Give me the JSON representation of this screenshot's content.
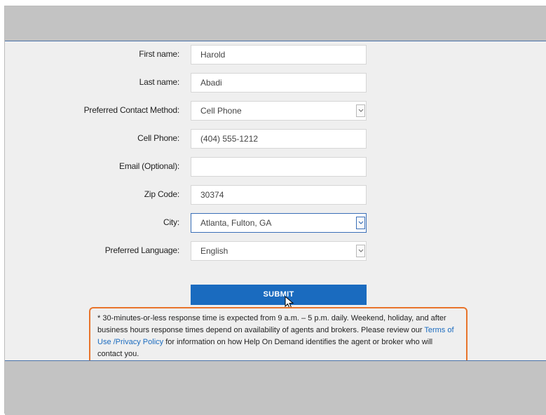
{
  "form": {
    "fields": [
      {
        "label": "First name:",
        "value": "Harold",
        "type": "text"
      },
      {
        "label": "Last name:",
        "value": "Abadi",
        "type": "text"
      },
      {
        "label": "Preferred Contact Method:",
        "value": "Cell Phone",
        "type": "select"
      },
      {
        "label": "Cell Phone:",
        "value": "(404) 555-1212",
        "type": "text"
      },
      {
        "label": "Email (Optional):",
        "value": "",
        "type": "text"
      },
      {
        "label": "Zip Code:",
        "value": "30374",
        "type": "text"
      },
      {
        "label": "City:",
        "value": "Atlanta, Fulton, GA",
        "type": "select"
      },
      {
        "label": "Preferred Language:",
        "value": "English",
        "type": "select"
      }
    ],
    "submit_label": "SUBMIT"
  },
  "notice": {
    "text_before": "* 30-minutes-or-less response time is expected from 9 a.m. – 5 p.m. daily. Weekend, holiday, and after business hours response times depend on availability of agents and brokers. Please review our ",
    "link_text": "Terms of Use /Privacy Policy",
    "text_after": " for information on how Help On Demand identifies the agent or broker who will contact you."
  },
  "colors": {
    "accent": "#1a6bbf",
    "highlight_border": "#e8742b",
    "band": "#c3c3c3",
    "background": "#efefef"
  },
  "icons": [
    "chevron-down-icon",
    "mouse-cursor-icon"
  ]
}
